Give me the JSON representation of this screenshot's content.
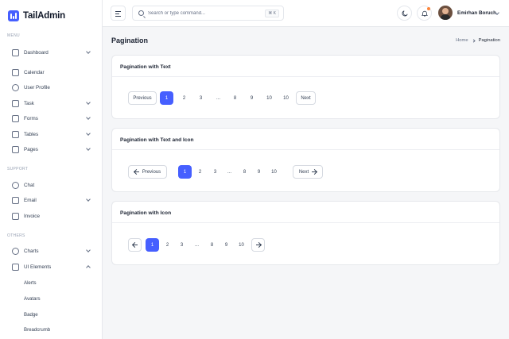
{
  "brand": {
    "name": "TailAdmin"
  },
  "sidebar": {
    "sections": [
      "MENU",
      "SUPPORT",
      "OTHERS"
    ],
    "items": [
      {
        "label": "Dashboard"
      },
      {
        "label": "Calendar"
      },
      {
        "label": "User Profile"
      },
      {
        "label": "Task"
      },
      {
        "label": "Forms"
      },
      {
        "label": "Tables"
      },
      {
        "label": "Pages"
      },
      {
        "label": "Chat"
      },
      {
        "label": "Email"
      },
      {
        "label": "Invoice"
      },
      {
        "label": "Charts"
      },
      {
        "label": "UI Elements"
      }
    ],
    "sub_items": [
      "Alerts",
      "Avatars",
      "Badge",
      "Breadcrumb"
    ]
  },
  "header": {
    "search_placeholder": "Search or type command...",
    "shortcut": "⌘ K",
    "user_name": "Emirhan Boruch"
  },
  "page": {
    "title": "Pagination",
    "breadcrumb": {
      "home": "Home",
      "current": "Pagination"
    }
  },
  "cards": [
    {
      "title": "Pagination with Text",
      "prev": "Previous",
      "next": "Next",
      "pages": [
        "1",
        "2",
        "3",
        "...",
        "8",
        "9",
        "10",
        "10"
      ],
      "active": "1"
    },
    {
      "title": "Pagination with Text and Icon",
      "prev": "Previous",
      "next": "Next",
      "pages": [
        "1",
        "2",
        "3",
        "...",
        "8",
        "9",
        "10"
      ],
      "active": "1"
    },
    {
      "title": "Pagination with Icon",
      "pages": [
        "1",
        "2",
        "3",
        "...",
        "8",
        "9",
        "10"
      ],
      "active": "1"
    }
  ],
  "colors": {
    "accent": "#465fff",
    "notification_dot": "#fd853a"
  }
}
